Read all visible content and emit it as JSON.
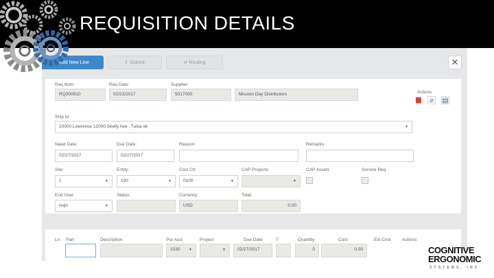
{
  "header": {
    "title": "REQUISITION DETAILS"
  },
  "toolbar": {
    "add_label": "Add New Line",
    "submit_label": "Submit",
    "routing_label": "Routing"
  },
  "form": {
    "req_num": {
      "label": "Req Num:",
      "value": "RQ000910"
    },
    "req_date": {
      "label": "Req Date:",
      "value": "02/23/2017"
    },
    "supplier": {
      "label": "Supplier:",
      "code": "5017000",
      "name": "Mission Day Distributors"
    },
    "actions_label": "Actions",
    "ship_to": {
      "label": "Ship to:",
      "value": "10000 Lowrence 12000 Skelly Ave , Tulsa ok"
    },
    "need_date": {
      "label": "Need Date:",
      "value": "02/27/2017"
    },
    "due_date": {
      "label": "Due Date:",
      "value": "02/27/2017"
    },
    "reason": {
      "label": "Reason:",
      "value": ""
    },
    "remarks": {
      "label": "Remarks:",
      "value": ""
    },
    "site": {
      "label": "Site:",
      "value": "1"
    },
    "entity": {
      "label": "Entity:",
      "value": "100"
    },
    "cost_ctr": {
      "label": "Cost Ctr:",
      "value": "0100"
    },
    "cap_projects": {
      "label": "CAP Projects:",
      "value": ""
    },
    "cap_assets": {
      "label": "CAP Assets"
    },
    "service_req": {
      "label": "Service Req"
    },
    "end_user": {
      "label": "End User:",
      "value": "reqn"
    },
    "status": {
      "label": "Status:",
      "value": ""
    },
    "currency": {
      "label": "Currency:",
      "value": "USD"
    },
    "total": {
      "label": "Total:",
      "value": "0.00"
    }
  },
  "lines": {
    "columns": [
      "Ln",
      "Part",
      "Description",
      "Pur Acct",
      "Project",
      "Due Date",
      "T",
      "Quantity",
      "Cost",
      "Ext Cost",
      "Actions"
    ],
    "row": {
      "pur_acct": "1030",
      "due_date": "02/27/2017",
      "quantity": "0",
      "cost": "0.00"
    }
  },
  "logo": {
    "line1": "COGNITIVE",
    "line2": "ERGONOMIC",
    "line3": "SYSTEMS, INC"
  },
  "colors": {
    "primary_button": "#3f88c8",
    "banner": "#000000",
    "pdf_icon": "#d9443a"
  }
}
